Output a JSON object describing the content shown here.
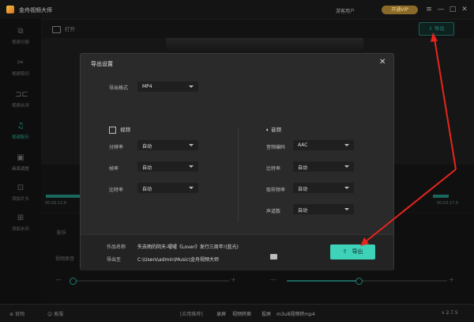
{
  "window": {
    "title": "金舟视频大师",
    "user": "游客用户",
    "vip_label": "开通VIP",
    "controls": [
      "≡",
      "—",
      "□",
      "✕"
    ]
  },
  "sidebar": {
    "items": [
      {
        "label": "视频分割",
        "icon": "split-icon"
      },
      {
        "label": "视频剪切",
        "icon": "cut-icon"
      },
      {
        "label": "视频合并",
        "icon": "merge-icon"
      },
      {
        "label": "视频配乐",
        "icon": "music-icon",
        "active": true
      },
      {
        "label": "画面调整",
        "icon": "adjust-icon"
      },
      {
        "label": "添加片头",
        "icon": "intro-icon"
      },
      {
        "label": "添加水印",
        "icon": "watermark-icon"
      }
    ]
  },
  "toolbar": {
    "open_label": "打开",
    "export_label": "导出"
  },
  "timeline": {
    "start": "00:00:13.6",
    "end": "00:03:17.6"
  },
  "bottom": {
    "tab_label": "配乐",
    "volume_label": "视频原音"
  },
  "statusbar": {
    "items": [
      {
        "label": "官网"
      },
      {
        "label": "客服"
      },
      {
        "label": "[应用推荐]"
      },
      {
        "label": "录屏"
      },
      {
        "label": "视频转换"
      },
      {
        "label": "投屏"
      },
      {
        "label": "m3u8视频转mp4"
      }
    ],
    "version": "v 2.7.5"
  },
  "dialog": {
    "title": "导出设置",
    "close": "✕",
    "format": {
      "label": "导出格式",
      "value": "MP4"
    },
    "video_section": "视频",
    "audio_section": "音频",
    "video": [
      {
        "label": "分辨率",
        "value": "自动"
      },
      {
        "label": "帧率",
        "value": "自动"
      },
      {
        "label": "比特率",
        "value": "自动"
      }
    ],
    "audio": [
      {
        "label": "音频编码",
        "value": "AAC"
      },
      {
        "label": "比特率",
        "value": "自动"
      },
      {
        "label": "取样频率",
        "value": "自动"
      },
      {
        "label": "声道数",
        "value": "自动"
      }
    ],
    "work_name_label": "作品名称",
    "work_name_value": "失去雨的阴天-嚯嚯《Lover》发行三周年!(蓝光)",
    "export_to_label": "导出至",
    "export_to_value": "C:\\Users\\admin\\Music\\金舟视频大师",
    "export_button": "导出"
  },
  "colors": {
    "accent": "#3ed2b8",
    "annotation": "#e8251c"
  }
}
